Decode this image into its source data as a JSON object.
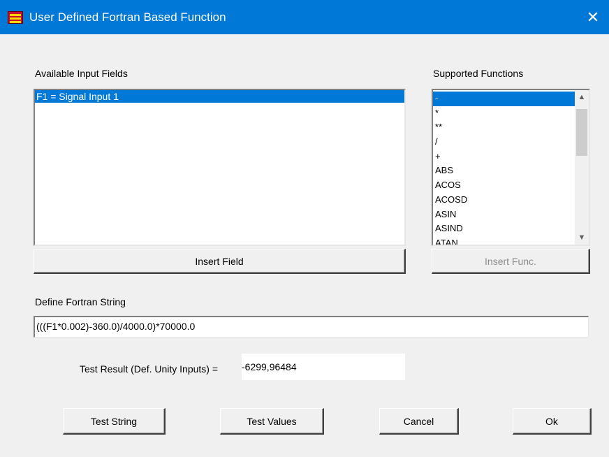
{
  "window": {
    "title": "User Defined Fortran Based Function",
    "close_glyph": "✕"
  },
  "input_fields": {
    "label": "Available Input Fields",
    "items": [
      "F1 = Signal Input 1"
    ],
    "selected_index": 0,
    "insert_button": "Insert Field"
  },
  "functions": {
    "label": "Supported Functions",
    "items": [
      "-",
      "*",
      "**",
      "/",
      "+",
      "ABS",
      "ACOS",
      "ACOSD",
      "ASIN",
      "ASIND",
      "ATAN"
    ],
    "selected_index": 0,
    "insert_button": "Insert Func."
  },
  "fortran": {
    "label": "Define Fortran String",
    "value": "(((F1*0.002)-360.0)/4000.0)*70000.0"
  },
  "test_result": {
    "label": "Test Result (Def. Unity Inputs) =",
    "value": "-6299,96484"
  },
  "buttons": {
    "test_string": "Test String",
    "test_values": "Test Values",
    "cancel": "Cancel",
    "ok": "Ok"
  },
  "colors": {
    "titlebar": "#0078d7",
    "selection": "#0078d7",
    "dialog_bg": "#f0f0f0"
  }
}
